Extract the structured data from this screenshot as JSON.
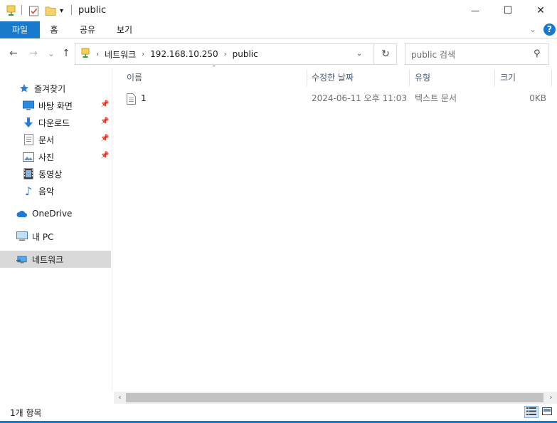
{
  "window": {
    "title": "public",
    "minimize_glyph": "—",
    "maximize_glyph": "☐",
    "close_glyph": "✕"
  },
  "ribbon": {
    "tabs": [
      "파일",
      "홈",
      "공유",
      "보기"
    ],
    "help_glyph": "?"
  },
  "nav": {
    "back_glyph": "←",
    "forward_glyph": "→",
    "recent_glyph": "⌄",
    "up_glyph": "↑",
    "breadcrumb": [
      "네트워크",
      "192.168.10.250",
      "public"
    ],
    "refresh_glyph": "↻"
  },
  "search": {
    "placeholder": "public 검색"
  },
  "sidebar": {
    "quick_access": "즐겨찾기",
    "items": [
      {
        "label": "바탕 화면",
        "icon": "desktop-icon",
        "pinned": true
      },
      {
        "label": "다운로드",
        "icon": "download-icon",
        "pinned": true
      },
      {
        "label": "문서",
        "icon": "document-icon",
        "pinned": true
      },
      {
        "label": "사진",
        "icon": "pictures-icon",
        "pinned": true
      },
      {
        "label": "동영상",
        "icon": "video-icon",
        "pinned": false
      },
      {
        "label": "음악",
        "icon": "music-icon",
        "pinned": false
      }
    ],
    "onedrive": "OneDrive",
    "this_pc": "내 PC",
    "network": "네트워크"
  },
  "columns": {
    "name": "이름",
    "modified": "수정한 날짜",
    "type": "유형",
    "size": "크기"
  },
  "files": [
    {
      "name": "1",
      "modified": "2024-06-11 오후 11:03",
      "type": "텍스트 문서",
      "size": "0KB"
    }
  ],
  "status": {
    "count": "1개 항목"
  },
  "colors": {
    "accent": "#1979ca",
    "selected_nav": "#d9d9d9",
    "header_text": "#4c607a"
  }
}
